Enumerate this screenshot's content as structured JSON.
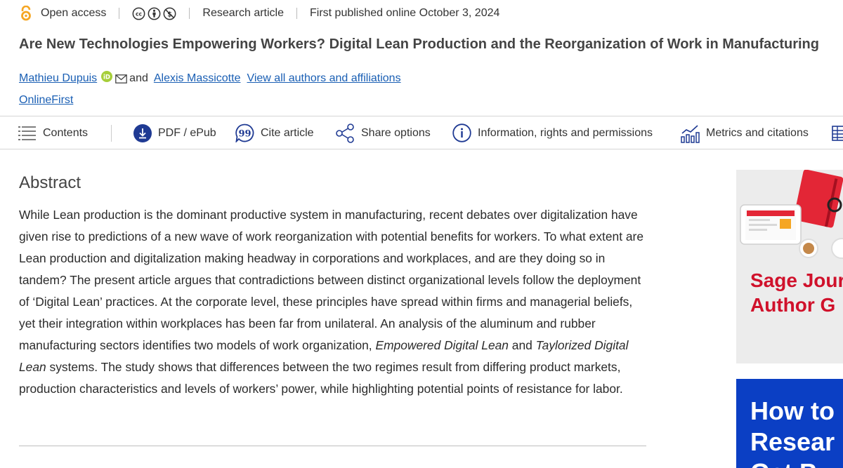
{
  "meta": {
    "access": "Open access",
    "license_icons": [
      "cc-icon",
      "by-icon",
      "nc-icon"
    ],
    "article_type": "Research article",
    "published": "First published online October 3, 2024"
  },
  "title": "Are New Technologies Empowering Workers? Digital Lean Production and the Reorganization of Work in Manufacturing",
  "authors": {
    "author1": "Mathieu Dupuis",
    "and": "and",
    "author2": "Alexis Massicotte",
    "view_all": "View all authors and affiliations"
  },
  "status": "OnlineFirst",
  "toolbar": {
    "contents": "Contents",
    "pdf": "PDF / ePub",
    "cite": "Cite article",
    "share": "Share options",
    "info": "Information, rights and permissions",
    "metrics": "Metrics and citations"
  },
  "abstract": {
    "heading": "Abstract",
    "part1": "While Lean production is the dominant productive system in manufacturing, recent debates over digitalization have given rise to predictions of a new wave of work reorganization with potential benefits for workers. To what extent are Lean production and digitalization making headway in corporations and workplaces, and are they doing so in tandem? The present article argues that contradictions between distinct organizational levels follow the deployment of ‘Digital Lean’ practices. At the corporate level, these principles have spread within firms and managerial beliefs, yet their integration within workplaces has been far from unilateral. An analysis of the aluminum and rubber manufacturing sectors identifies two models of work organization, ",
    "em1": "Empowered Digital Lean",
    "part2": " and ",
    "em2": "Taylorized Digital Lean",
    "part3": " systems. The study shows that differences between the two regimes result from differing product markets, production characteristics and levels of workers’ power, while highlighting potential points of resistance for labor."
  },
  "ads": {
    "ad1_line1": "Sage Jour",
    "ad1_line2": "Author G",
    "ad2_line1": "How to",
    "ad2_line2": "Resear",
    "ad2_line3": "Get Pu"
  },
  "colors": {
    "link": "#1a5fb4",
    "oa_orange": "#f5a623",
    "orcid_green": "#a6ce39",
    "toolbar_icon": "#1f3a93",
    "ad_red": "#d0112b",
    "ad_blue": "#0b3fc4"
  }
}
